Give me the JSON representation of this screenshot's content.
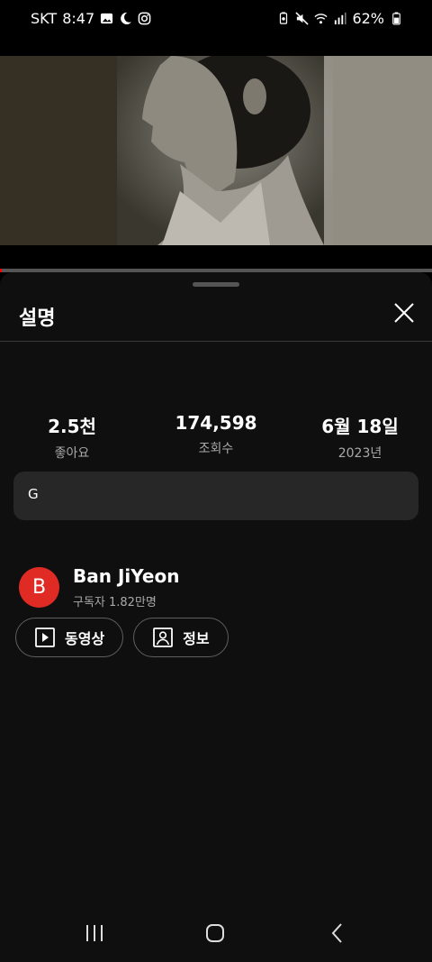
{
  "status_bar": {
    "carrier": "SKT",
    "time": "8:47",
    "battery": "62%",
    "left_icons": [
      "gallery-icon",
      "moon-icon",
      "instagram-icon"
    ],
    "right_icons": [
      "battery-saver-icon",
      "mute-icon",
      "wifi-icon",
      "signal-icon",
      "battery-icon"
    ]
  },
  "video": {
    "progress_fraction": 0.005
  },
  "sheet": {
    "title": "설명",
    "close_icon": "close-icon"
  },
  "stats": [
    {
      "value": "2.5천",
      "label": "좋아요"
    },
    {
      "value": "174,598",
      "label": "조회수"
    },
    {
      "value": "6월 18일",
      "label": "2023년"
    }
  ],
  "description": "G",
  "channel": {
    "avatar_letter": "B",
    "avatar_color": "#e02a24",
    "name": "Ban JiYeon",
    "subscribers": "구독자 1.82만명"
  },
  "chips": [
    {
      "icon": "play-box-icon",
      "label": "동영상"
    },
    {
      "icon": "person-box-icon",
      "label": "정보"
    }
  ],
  "nav_bar": [
    "recents-icon",
    "home-icon",
    "back-icon"
  ]
}
